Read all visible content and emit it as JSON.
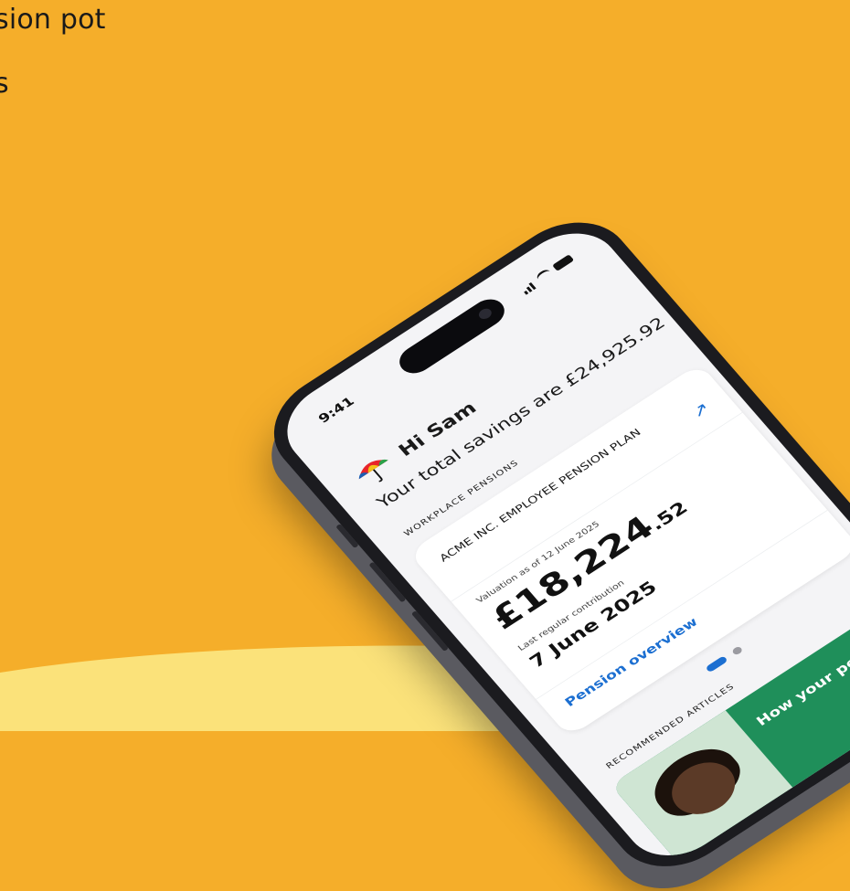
{
  "background": {
    "color": "#f5ae2a",
    "hero_line_1": "sion pot",
    "hero_line_2": "s"
  },
  "status_bar": {
    "time": "9:41",
    "icons": [
      "signal-icon",
      "wifi-icon",
      "battery-icon"
    ]
  },
  "header": {
    "logo_icon": "umbrella-icon",
    "greeting": "Hi Sam",
    "total_savings_text": "Your total savings are £24,925.92"
  },
  "workplace_pensions": {
    "section_label": "WORKPLACE PENSIONS",
    "card": {
      "plan_name": "ACME INC. EMPLOYEE PENSION PLAN",
      "valuation_label": "Valuation as of 12 June 2025",
      "valuation_pounds": "£18,224",
      "valuation_pence": ".52",
      "contribution_label": "Last regular contribution",
      "contribution_date": "7 June 2025",
      "link_label": "Pension overview",
      "arrow_icon": "arrow-up-right-icon"
    }
  },
  "pagination": {
    "active_index": 0,
    "count": 2
  },
  "articles": {
    "section_label": "RECOMMENDED ARTICLES",
    "items": [
      {
        "title": "How your pension"
      }
    ]
  },
  "colors": {
    "accent": "#1c6fd1",
    "article_green": "#1f8f5a",
    "page_bg": "#f5ae2a",
    "bottom_band": "#fbe27a"
  }
}
